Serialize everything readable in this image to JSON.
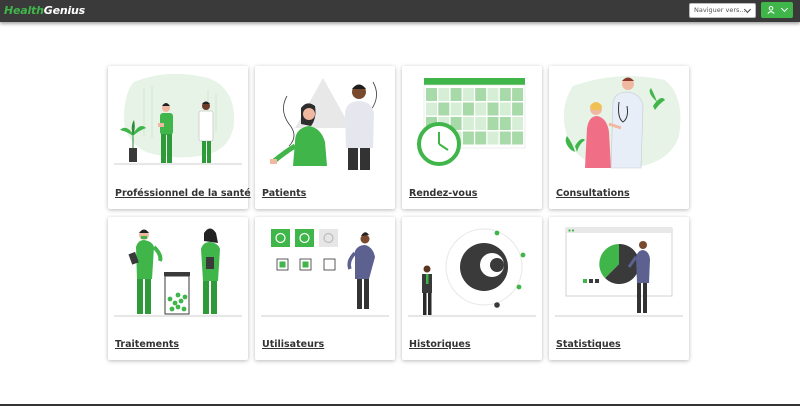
{
  "app": {
    "logo_part1": "Health",
    "logo_part2": "Genius"
  },
  "header": {
    "nav_placeholder": "Naviguer vers...",
    "user_icon": "user-icon",
    "dropdown_icon": "chevron-down-icon"
  },
  "colors": {
    "accent": "#3fb54a",
    "topbar": "#3a3a3a",
    "card_label": "#333333"
  },
  "cards": [
    {
      "label": "Proféssionnel de la santé",
      "illustration": "health-professionals-illustration"
    },
    {
      "label": "Patients",
      "illustration": "patients-illustration"
    },
    {
      "label": "Rendez-vous",
      "illustration": "calendar-illustration"
    },
    {
      "label": "Consultations",
      "illustration": "consultation-illustration"
    },
    {
      "label": "Traitements",
      "illustration": "treatment-illustration"
    },
    {
      "label": "Utilisateurs",
      "illustration": "users-illustration"
    },
    {
      "label": "Historiques",
      "illustration": "history-illustration"
    },
    {
      "label": "Statistiques",
      "illustration": "statistics-illustration"
    }
  ]
}
